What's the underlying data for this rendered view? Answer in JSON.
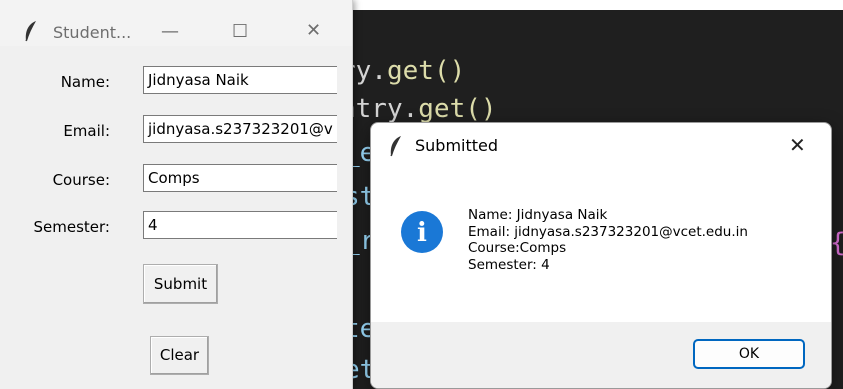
{
  "student_window": {
    "title": "Student...",
    "controls": {
      "minimize": "—",
      "maximize": "☐",
      "close": "✕"
    },
    "fields": [
      {
        "label": "Name:",
        "value": "Jidnyasa Naik"
      },
      {
        "label": "Email:",
        "value": "jidnyasa.s237323201@v"
      },
      {
        "label": "Course:",
        "value": "Comps"
      },
      {
        "label": "Semester:",
        "value": "4"
      }
    ],
    "submit_label": "Submit",
    "clear_label": "Clear"
  },
  "dialog": {
    "title": "Submitted",
    "close": "✕",
    "icon": "info-icon",
    "icon_glyph": "i",
    "lines": [
      "Name: Jidnyasa Naik",
      "Email: jidnyasa.s237323201@vcet.edu.in",
      "Course:Comps",
      "Semester: 4"
    ],
    "ok_label": "OK"
  },
  "editor": {
    "line1_a": "ry.",
    "line1_b": "get",
    "line1_c": "()",
    "line2_a": "ntry.",
    "line2_b": "get",
    "line2_c": "()",
    "frag_e": "_e",
    "frag_st": "st",
    "frag_lr": "_r",
    "brace": "{",
    "frag_te": "te",
    "frag_et": "et",
    "frag_t": "t"
  },
  "colors": {
    "editor_bg": "#1f1f1f",
    "info_blue": "#1a78d6",
    "ok_border": "#0067c0"
  }
}
